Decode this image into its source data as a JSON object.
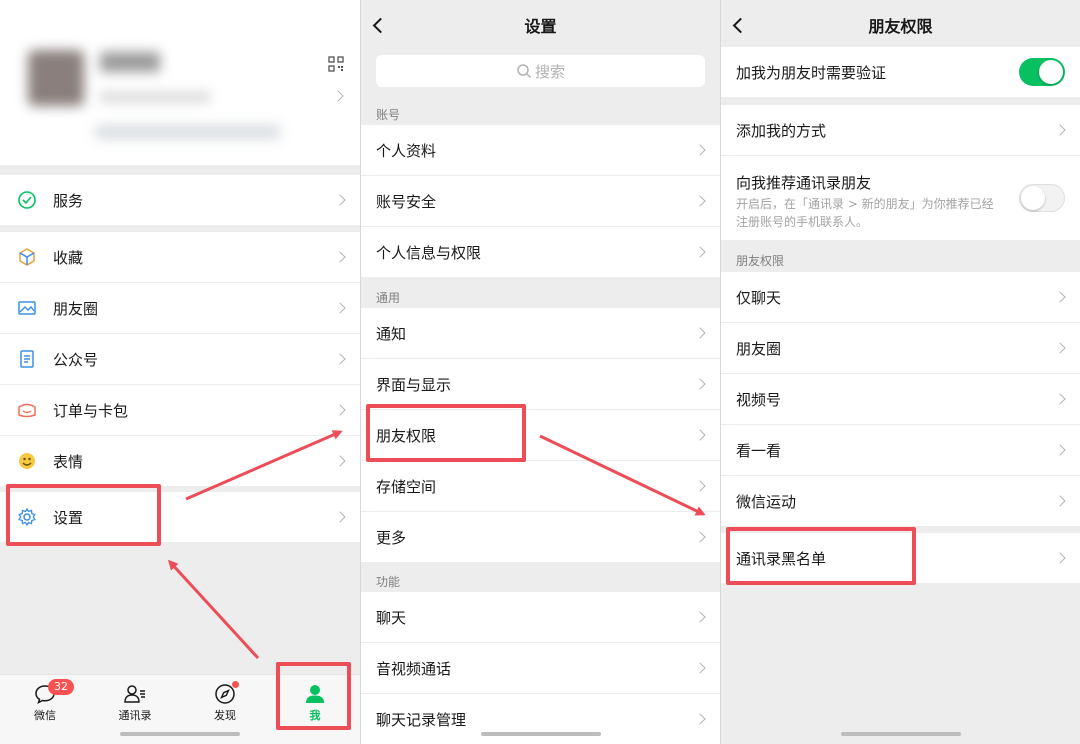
{
  "colors": {
    "accent": "#07c160",
    "highlight": "#ec4d57",
    "bg": "#ededed"
  },
  "me_page": {
    "menu": {
      "services": "服务",
      "favorites": "收藏",
      "moments": "朋友圈",
      "official_accounts": "公众号",
      "orders": "订单与卡包",
      "stickers": "表情",
      "settings": "设置"
    },
    "tabbar": {
      "chats": "微信",
      "chats_badge": "32",
      "contacts": "通讯录",
      "discover": "发现",
      "me": "我"
    }
  },
  "settings_page": {
    "title": "设置",
    "search_placeholder": "搜索",
    "section_account": "账号",
    "profile": "个人资料",
    "account_security": "账号安全",
    "personal_info": "个人信息与权限",
    "section_general": "通用",
    "notifications": "通知",
    "display": "界面与显示",
    "friend_permissions": "朋友权限",
    "storage": "存储空间",
    "more": "更多",
    "section_features": "功能",
    "chat": "聊天",
    "calls": "音视频通话",
    "chat_history": "聊天记录管理"
  },
  "friend_permissions_page": {
    "title": "朋友权限",
    "require_verification": "加我为朋友时需要验证",
    "require_verification_on": true,
    "add_methods": "添加我的方式",
    "recommend_contacts": "向我推荐通讯录朋友",
    "recommend_contacts_desc": "开启后，在「通讯录 > 新的朋友」为你推荐已经注册账号的手机联系人。",
    "recommend_contacts_on": false,
    "section_friend_permissions": "朋友权限",
    "chat_only": "仅聊天",
    "moments": "朋友圈",
    "channels": "视频号",
    "top_stories": "看一看",
    "werun": "微信运动",
    "blocked_list": "通讯录黑名单"
  }
}
